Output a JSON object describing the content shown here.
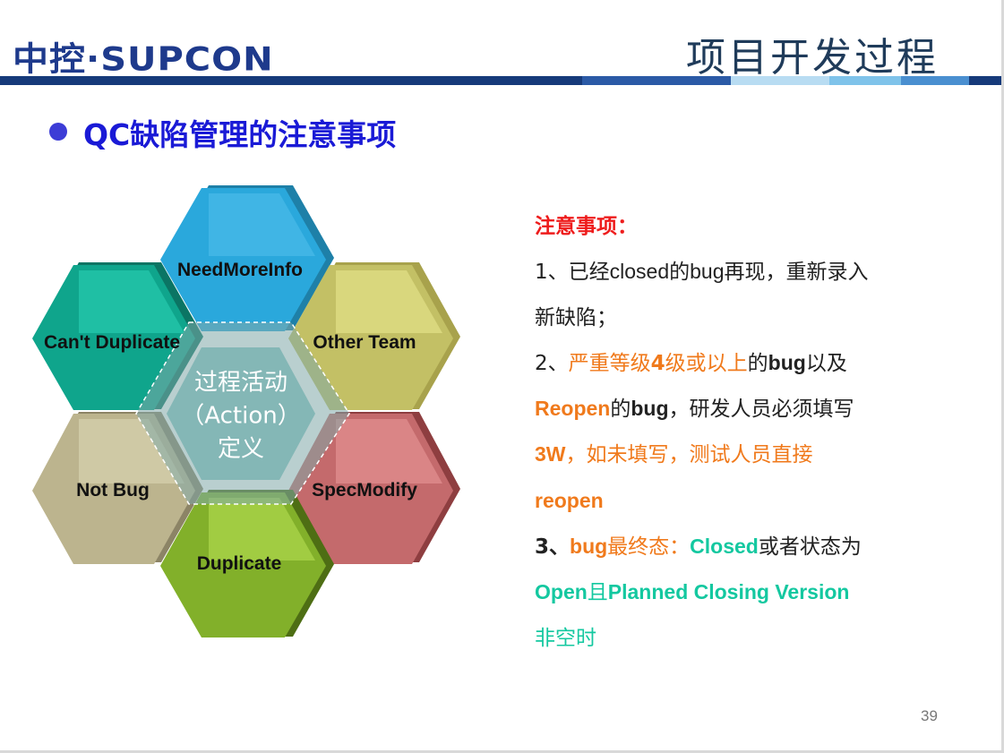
{
  "header": {
    "logo_text": "中控·SUPCON",
    "title": "项目开发过程",
    "bar_segments": [
      "#163a7a",
      "#2b5aa6",
      "#b8dcf2",
      "#7fc3ea",
      "#4a8fd0",
      "#163a7a"
    ]
  },
  "heading": "QC缺陷管理的注意事项",
  "diagram": {
    "center": [
      "过程活动",
      "（Action）",
      "定义"
    ],
    "hexagons": [
      {
        "label": "NeedMoreInfo",
        "color": "#2aa8dc"
      },
      {
        "label": "Can't Duplicate",
        "color": "#0fa58c"
      },
      {
        "label": "Other Team",
        "color": "#c3c065"
      },
      {
        "label": "Not Bug",
        "color": "#bcb48e"
      },
      {
        "label": "SpecModify",
        "color": "#c46a6c"
      },
      {
        "label": "Duplicate",
        "color": "#82b02a"
      }
    ]
  },
  "notes": {
    "title": "注意事项：",
    "item1_a": "1、已经",
    "item1_b": "closed",
    "item1_c": "的",
    "item1_d": "bug",
    "item1_e": "再现，重新录入",
    "item1_f": "新缺陷；",
    "item2_a": "2、",
    "item2_b": "严重等级",
    "item2_c": "4",
    "item2_d": "级或以上",
    "item2_e": "的",
    "item2_f": "bug",
    "item2_g": "以及",
    "item2_h": "Reopen",
    "item2_i": "的",
    "item2_j": "bug",
    "item2_k": "，研发人员必须填写",
    "item2_l": "3W",
    "item2_m": "，如未填写，测试人员直接",
    "item2_n": "reopen",
    "item3_a": "3、",
    "item3_b": "bug",
    "item3_c": "最终态：",
    "item3_d": "Closed",
    "item3_e": "或者状态为",
    "item3_f": "Open",
    "item3_g": "且",
    "item3_h": "Planned Closing Version",
    "item3_i": "非空时"
  },
  "page_number": "39"
}
